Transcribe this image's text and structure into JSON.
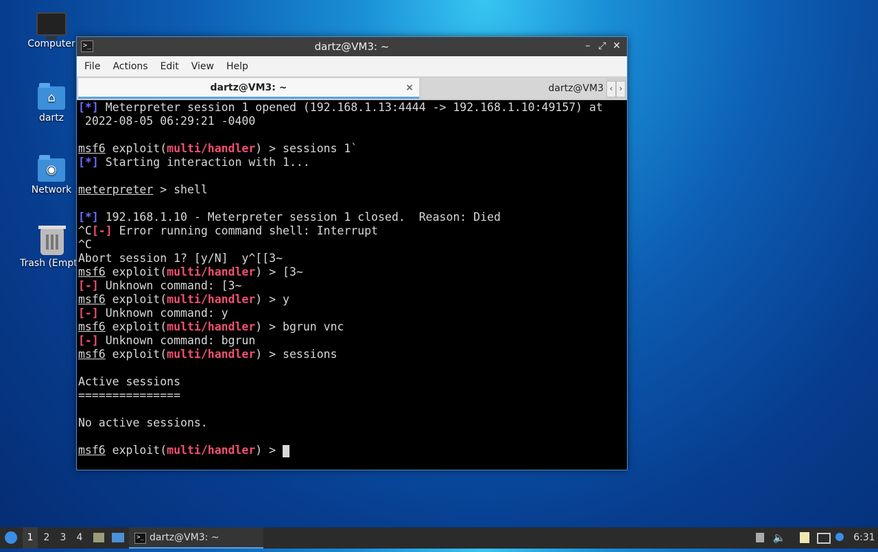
{
  "desktop": {
    "icons": [
      {
        "label": "Computer"
      },
      {
        "label": "dartz"
      },
      {
        "label": "Network"
      },
      {
        "label": "Trash (Empt"
      }
    ]
  },
  "window": {
    "title": "dartz@VM3: ~",
    "app_icon": ">_",
    "controls": {
      "minimize": "–",
      "maximize": "⤢",
      "close": "✕"
    }
  },
  "menu": [
    "File",
    "Edit",
    "View",
    "Help"
  ],
  "menu_items": {
    "file": "File",
    "actions": "Actions",
    "edit": "Edit",
    "view": "View",
    "help": "Help"
  },
  "tabs": {
    "active": "dartz@VM3: ~",
    "other": "dartz@VM3",
    "close": "×",
    "scroll_left": "‹",
    "scroll_right": "›"
  },
  "terminal": {
    "lines": [
      [
        {
          "t": "[*]",
          "c": "blue"
        },
        {
          "t": " Meterpreter session 1 opened (192.168.1.13:4444 -> 192.168.1.10:49157) at"
        }
      ],
      [
        {
          "t": " 2022-08-05 06:29:21 -0400"
        }
      ],
      [],
      [
        {
          "t": "msf6",
          "c": "u"
        },
        {
          "t": " exploit("
        },
        {
          "t": "multi/handler",
          "c": "red"
        },
        {
          "t": ") > sessions 1`"
        }
      ],
      [
        {
          "t": "[*]",
          "c": "blue"
        },
        {
          "t": " Starting interaction with 1..."
        }
      ],
      [],
      [
        {
          "t": "meterpreter",
          "c": "u"
        },
        {
          "t": " > shell"
        }
      ],
      [],
      [
        {
          "t": "[*]",
          "c": "blue"
        },
        {
          "t": " 192.168.1.10 - Meterpreter session 1 closed.  Reason: Died"
        }
      ],
      [
        {
          "t": "^C"
        },
        {
          "t": "[-]",
          "c": "red"
        },
        {
          "t": " Error running command shell: Interrupt"
        }
      ],
      [
        {
          "t": "^C"
        }
      ],
      [
        {
          "t": "Abort session 1? [y/N]  y^[[3~"
        }
      ],
      [
        {
          "t": "msf6",
          "c": "u"
        },
        {
          "t": " exploit("
        },
        {
          "t": "multi/handler",
          "c": "red"
        },
        {
          "t": ") > [3~"
        }
      ],
      [
        {
          "t": "[-]",
          "c": "red"
        },
        {
          "t": " Unknown command: [3~"
        }
      ],
      [
        {
          "t": "msf6",
          "c": "u"
        },
        {
          "t": " exploit("
        },
        {
          "t": "multi/handler",
          "c": "red"
        },
        {
          "t": ") > y"
        }
      ],
      [
        {
          "t": "[-]",
          "c": "red"
        },
        {
          "t": " Unknown command: y"
        }
      ],
      [
        {
          "t": "msf6",
          "c": "u"
        },
        {
          "t": " exploit("
        },
        {
          "t": "multi/handler",
          "c": "red"
        },
        {
          "t": ") > bgrun vnc"
        }
      ],
      [
        {
          "t": "[-]",
          "c": "red"
        },
        {
          "t": " Unknown command: bgrun"
        }
      ],
      [
        {
          "t": "msf6",
          "c": "u"
        },
        {
          "t": " exploit("
        },
        {
          "t": "multi/handler",
          "c": "red"
        },
        {
          "t": ") > sessions"
        }
      ],
      [],
      [
        {
          "t": "Active sessions"
        }
      ],
      [
        {
          "t": "==============="
        }
      ],
      [],
      [
        {
          "t": "No active sessions."
        }
      ],
      [],
      [
        {
          "t": "msf6",
          "c": "u"
        },
        {
          "t": " exploit("
        },
        {
          "t": "multi/handler",
          "c": "red"
        },
        {
          "t": ") > "
        },
        {
          "t": "",
          "c": "cursor"
        }
      ]
    ]
  },
  "taskbar": {
    "workspaces": [
      "1",
      "2",
      "3",
      "4"
    ],
    "task_label": "dartz@VM3: ~",
    "task_icon": ">_",
    "clock": "6:31",
    "tray_icons": [
      "storage-icon",
      "volume-icon",
      "clipboard-icon",
      "network-icon",
      "notification-icon"
    ]
  },
  "colors": {
    "accent": "#5aa3e0",
    "red": "#f0506e",
    "blue": "#6a6aff"
  }
}
